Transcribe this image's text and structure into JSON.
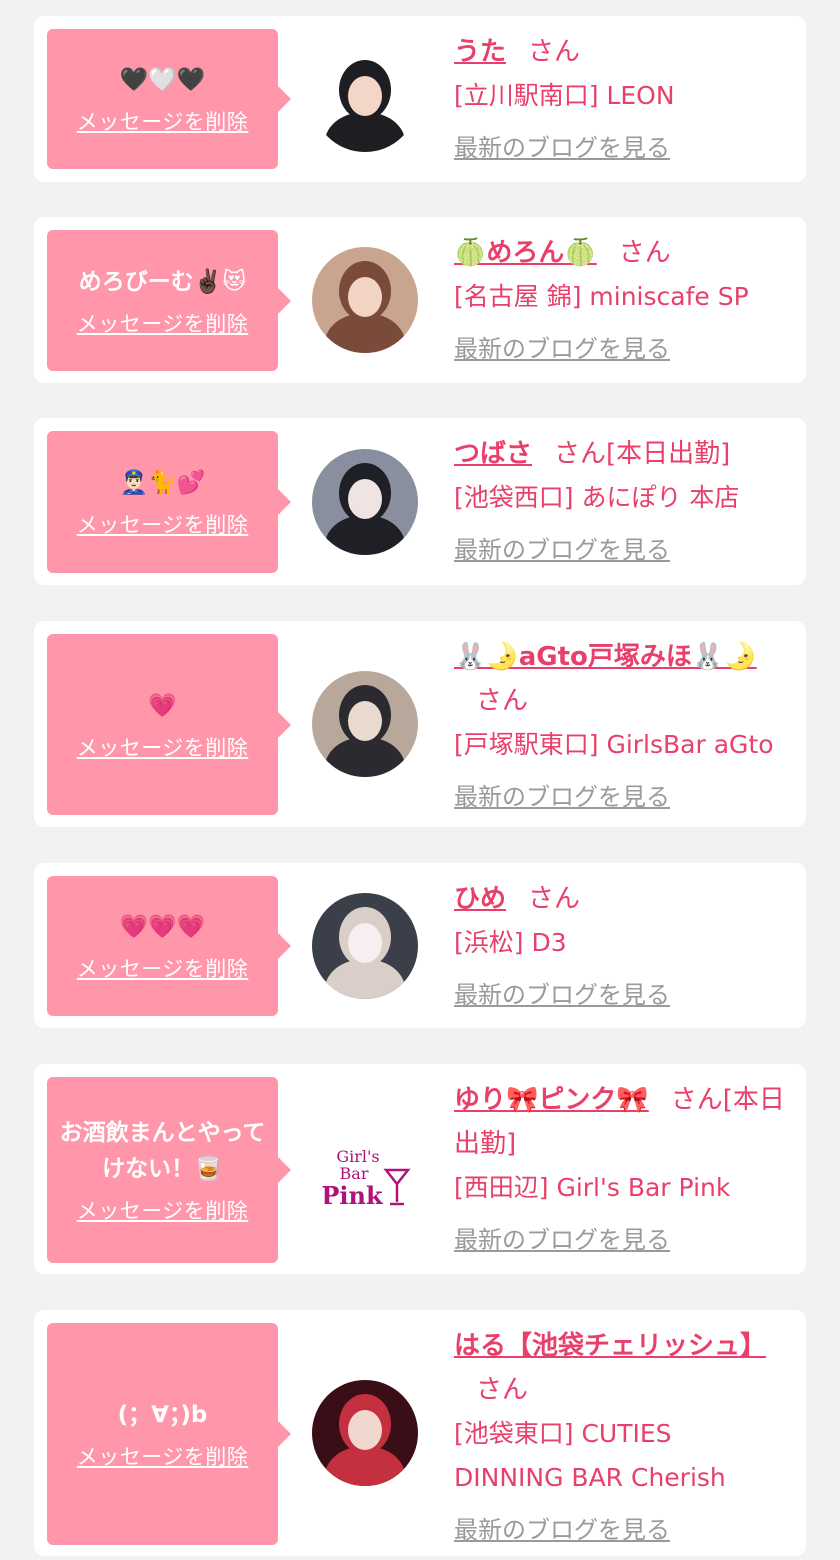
{
  "accent_color": "#e8406a",
  "bubble_color": "#ff96aa",
  "delete_label": "メッセージを削除",
  "blog_label": "最新のブログを見る",
  "san_label": "さん",
  "cards": [
    {
      "message": "🖤🤍🖤",
      "name": "うた",
      "status": "",
      "shop": "[立川駅南口] LEON",
      "avatar": "photo-1"
    },
    {
      "message": "めろびーむ✌🏿😻",
      "name": "🍈めろん🍈",
      "status": "",
      "shop": "[名古屋 錦] miniscafe SP",
      "avatar": "photo-2"
    },
    {
      "message": "👮🏻‍♂️🐈💕",
      "name": "つばさ",
      "status": "[本日出勤]",
      "shop": "[池袋西口] あにぽり 本店",
      "avatar": "photo-3"
    },
    {
      "message": "💗",
      "name": "🐰🌛aGto戸塚みほ🐰🌛",
      "status": "",
      "shop": "[戸塚駅東口] GirlsBar aGto",
      "avatar": "photo-4"
    },
    {
      "message": "💗💗💗",
      "name": "ひめ",
      "status": "",
      "shop": "[浜松] D3",
      "avatar": "photo-5"
    },
    {
      "message": "お酒飲まんとやってけない！🥃",
      "name": "ゆり🎀ピンク🎀",
      "status": "[本日出勤]",
      "shop": "[西田辺] Girl's Bar Pink",
      "avatar": "logo",
      "logo": {
        "line1": "Girl's",
        "line2": "Bar",
        "line3": "Pink"
      }
    },
    {
      "message": "(；∀；)b",
      "name": "はる【池袋チェリッシュ】",
      "status": "",
      "shop": "[池袋東口] CUTIES DINNING BAR Cherish",
      "avatar": "photo-7"
    }
  ]
}
